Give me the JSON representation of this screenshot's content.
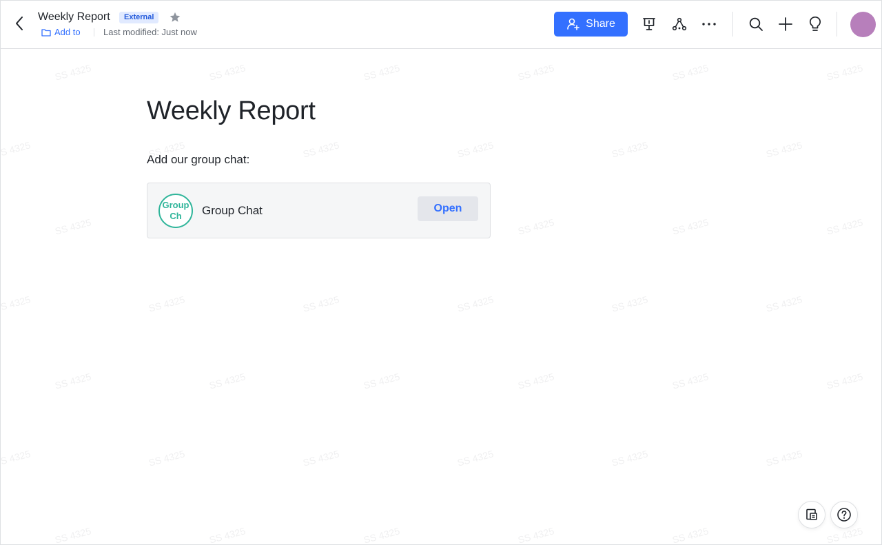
{
  "header": {
    "doc_title": "Weekly Report",
    "tag": "External",
    "add_to": "Add to",
    "last_modified": "Last modified: Just now",
    "share_label": "Share"
  },
  "icons": {
    "back": "chevron-left-icon",
    "star": "star-icon",
    "folder": "folder-icon",
    "share": "add-person-icon",
    "present": "presentation-icon",
    "tree": "org-tree-icon",
    "more": "more-icon",
    "search": "search-icon",
    "add": "plus-icon",
    "tip": "lightbulb-icon",
    "outline": "outline-icon",
    "help": "help-icon"
  },
  "document": {
    "title": "Weekly Report",
    "intro": "Add our group chat:",
    "chat_card": {
      "avatar_text": "Group Ch",
      "name": "Group Chat",
      "open_label": "Open"
    }
  },
  "watermark": "SS 4325",
  "colors": {
    "accent": "#3370ff",
    "tag_bg": "#e1eaff",
    "avatar": "#b77fbb",
    "chat_avatar": "#2fb59a"
  }
}
